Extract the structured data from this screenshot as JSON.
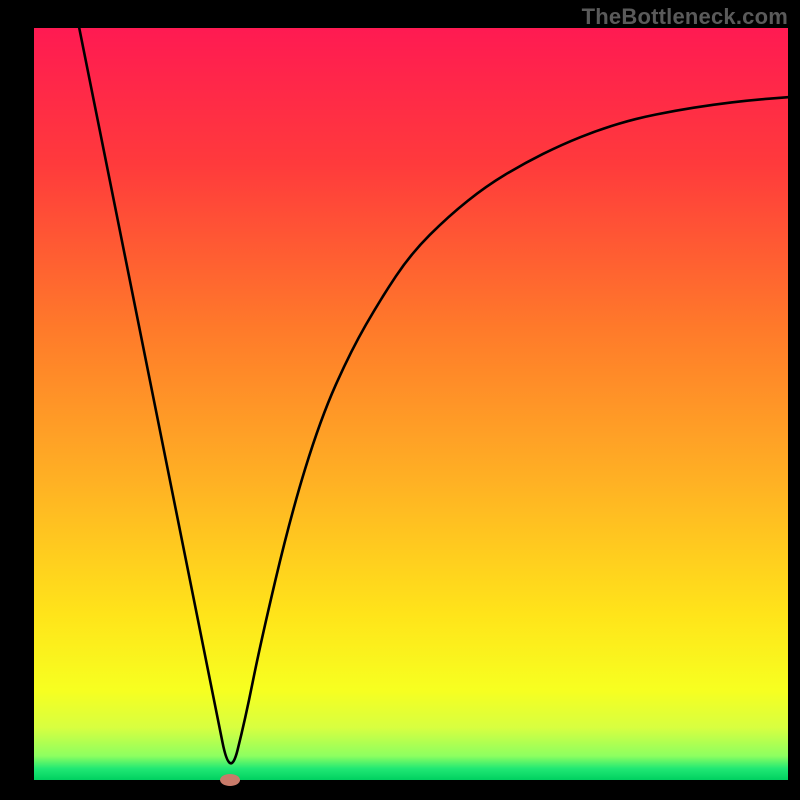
{
  "watermark": "TheBottleneck.com",
  "chart_data": {
    "type": "line",
    "title": "",
    "xlabel": "",
    "ylabel": "",
    "xlim": [
      0,
      100
    ],
    "ylim": [
      0,
      100
    ],
    "x": [
      6,
      10,
      14,
      18,
      22,
      24,
      26,
      28,
      30,
      34,
      38,
      42,
      46,
      50,
      55,
      60,
      65,
      70,
      75,
      80,
      85,
      90,
      95,
      100
    ],
    "y": [
      100,
      80,
      60,
      40,
      20,
      10,
      0,
      8,
      18,
      35,
      48,
      57,
      64,
      70,
      75,
      79,
      82,
      84.5,
      86.5,
      88,
      89,
      89.8,
      90.4,
      90.8
    ],
    "minimum_x": 26,
    "gradient_stops": [
      {
        "offset": 0.0,
        "color": "#ff1a52"
      },
      {
        "offset": 0.18,
        "color": "#ff3a3c"
      },
      {
        "offset": 0.4,
        "color": "#ff7a2a"
      },
      {
        "offset": 0.6,
        "color": "#ffb024"
      },
      {
        "offset": 0.78,
        "color": "#ffe41a"
      },
      {
        "offset": 0.88,
        "color": "#f7ff20"
      },
      {
        "offset": 0.93,
        "color": "#d8ff40"
      },
      {
        "offset": 0.968,
        "color": "#8dff60"
      },
      {
        "offset": 0.985,
        "color": "#20e874"
      },
      {
        "offset": 1.0,
        "color": "#00d060"
      }
    ],
    "marker": {
      "x": 26,
      "y": 0,
      "rx": 10,
      "ry": 6,
      "color": "#c97b6a"
    }
  }
}
